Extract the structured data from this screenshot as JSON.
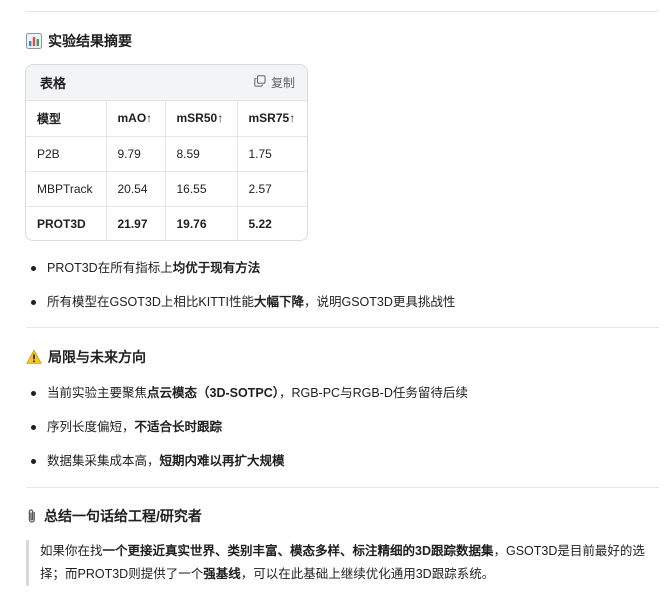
{
  "summary": {
    "heading": "实验结果摘要",
    "table": {
      "title": "表格",
      "copy_label": "复制",
      "headers": [
        "模型",
        "mAO↑",
        "mSR50↑",
        "mSR75↑"
      ],
      "rows": [
        [
          "P2B",
          "9.79",
          "8.59",
          "1.75"
        ],
        [
          "MBPTrack",
          "20.54",
          "16.55",
          "2.57"
        ],
        [
          "PROT3D",
          "21.97",
          "19.76",
          "5.22"
        ]
      ]
    },
    "bullets": [
      {
        "pre": "PROT3D在所有指标上",
        "bold": "均优于现有方法",
        "post": ""
      },
      {
        "pre": "所有模型在GSOT3D上相比KITTI性能",
        "bold": "大幅下降",
        "post": "，说明GSOT3D更具挑战性"
      }
    ]
  },
  "limits": {
    "heading": "局限与未来方向",
    "bullets": [
      {
        "pre": "当前实验主要聚焦",
        "bold": "点云模态（3D-SOTPC）",
        "post": "，RGB-PC与RGB-D任务留待后续"
      },
      {
        "pre": "序列长度偏短，",
        "bold": "不适合长时跟踪",
        "post": ""
      },
      {
        "pre": "数据集采集成本高，",
        "bold": "短期内难以再扩大规模",
        "post": ""
      }
    ]
  },
  "conclusion": {
    "heading": "总结一句话给工程/研究者",
    "quote": {
      "p1": "如果你在找",
      "b1": "一个更接近真实世界、类别丰富、模态多样、标注精细的3D跟踪数据集",
      "p2": "，GSOT3D是目前最好的选择；而PROT3D则提供了一个",
      "b2": "强基线",
      "p3": "，可以在此基础上继续优化通用3D跟踪系统。"
    }
  }
}
